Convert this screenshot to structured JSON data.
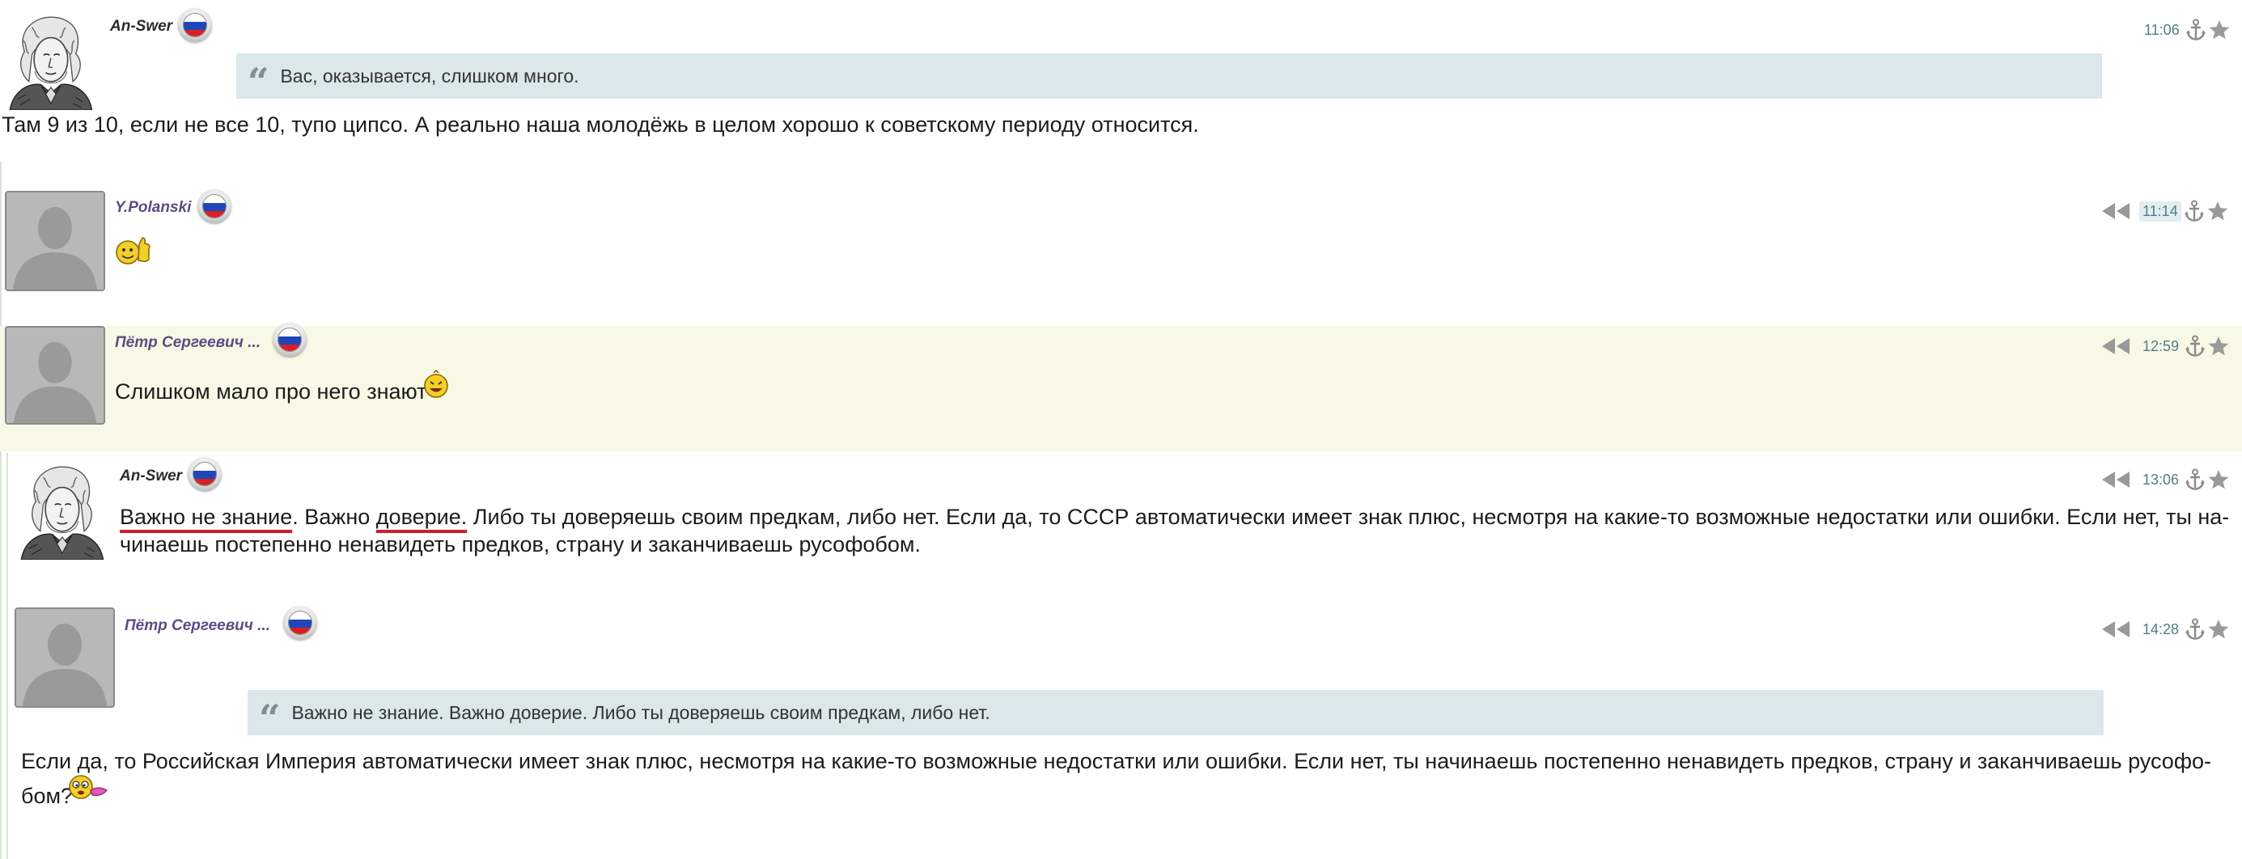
{
  "comments": [
    {
      "author": "An-Swer",
      "time": "11:06",
      "avatar_icon": "lomonosov-portrait",
      "flag_icon": "russia-flag-icon",
      "quote": "Вас, оказывается, слишком много.",
      "text": "Там 9 из 10, если не все 10, тупо ципсо. А реально наша молодёжь в целом хорошо к советскому периоду относится."
    },
    {
      "author": "Y.Polanski",
      "time": "11:14",
      "avatar_icon": "default-avatar-silhouette",
      "flag_icon": "russia-flag-icon",
      "text_icon": "thumbs-up-smiley"
    },
    {
      "author": "Пётр Сергеевич ...",
      "time": "12:59",
      "avatar_icon": "default-avatar-silhouette",
      "flag_icon": "russia-flag-icon",
      "text": "Слишком мало про него знают",
      "text_icon": "laughing-smiley"
    },
    {
      "author": "An-Swer",
      "time": "13:06",
      "avatar_icon": "lomonosov-portrait",
      "flag_icon": "russia-flag-icon",
      "text_underlined_1": "Важно не знание",
      "text_part_2": ". Важно ",
      "text_underlined_2": "доверие.",
      "text_part_3": " Либо ты доверяешь своим предкам, либо нет. Если да, то СССР автоматически имеет знак плюс, несмотря на какие-то возможные недостатки или ошибки. Если нет, ты на-",
      "text_line_2": "чинаешь постепенно ненавидеть предков, страну и заканчиваешь русофобом."
    },
    {
      "author": "Пётр Сергеевич ...",
      "time": "14:28",
      "avatar_icon": "default-avatar-silhouette",
      "flag_icon": "russia-flag-icon",
      "quote": "Важно не знание. Важно доверие. Либо ты доверяешь своим предкам, либо нет.",
      "text_line_1": "Если да, то Российская Империя автоматически имеет знак плюс, несмотря на какие-то возможные недостатки или ошибки. Если нет, ты начинаешь постепенно ненавидеть предков, страну и заканчиваешь русофо-",
      "text_line_2": "бом?",
      "text_icon": "confused-smiley"
    }
  ],
  "colors": {
    "highlight_background": "#f8f8e6",
    "quote_background": "#dbe7ea",
    "timestamp": "#4d7f8a",
    "author_purple": "#5e4a84",
    "underline": "#c8202c"
  }
}
